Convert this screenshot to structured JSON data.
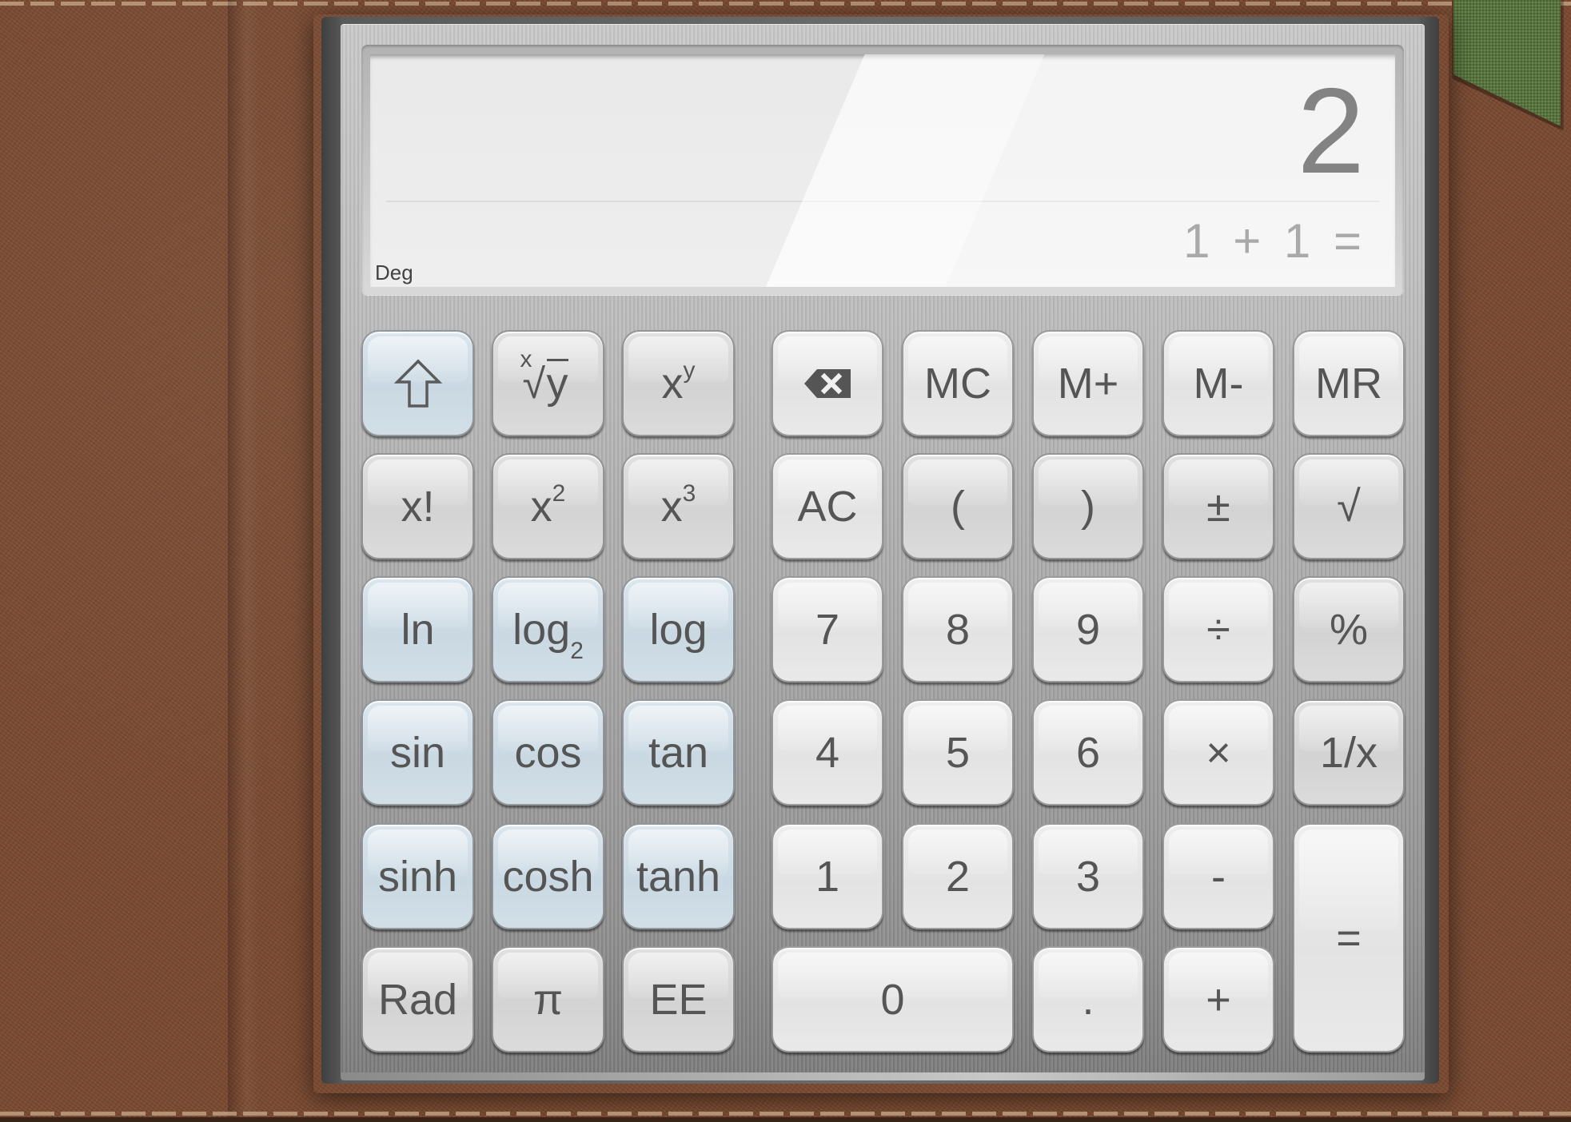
{
  "display": {
    "result": "2",
    "expression": "1 + 1 =",
    "angle_mode": "Deg"
  },
  "settings": {
    "icon": "gear-icon"
  },
  "keys": {
    "shift": {
      "icon": "shift-arrow-icon"
    },
    "root_xy": {
      "label": "ʸ",
      "root": "√",
      "index": "x",
      "radicand": "y"
    },
    "x_pow_y": {
      "base": "x",
      "exp": "y"
    },
    "backspace": {
      "icon": "backspace-icon"
    },
    "mc": "MC",
    "m_plus": "M+",
    "m_minus": "M-",
    "mr": "MR",
    "factorial": "x!",
    "x_squared": {
      "base": "x",
      "exp": "2"
    },
    "x_cubed": {
      "base": "x",
      "exp": "3"
    },
    "ac": "AC",
    "open_paren": "(",
    "close_paren": ")",
    "plus_minus": "±",
    "sqrt": "√",
    "ln": "ln",
    "log2": {
      "base": "log",
      "sub": "2"
    },
    "log": "log",
    "seven": "7",
    "eight": "8",
    "nine": "9",
    "divide": "÷",
    "percent": "%",
    "sin": "sin",
    "cos": "cos",
    "tan": "tan",
    "four": "4",
    "five": "5",
    "six": "6",
    "multiply": "×",
    "reciprocal": "1/x",
    "sinh": "sinh",
    "cosh": "cosh",
    "tanh": "tanh",
    "one": "1",
    "two": "2",
    "three": "3",
    "minus": "-",
    "equals": "=",
    "rad": "Rad",
    "pi": "π",
    "ee": "EE",
    "zero": "0",
    "decimal": ".",
    "plus": "+"
  },
  "colors": {
    "leather": "#7b4a31",
    "ribbon": "#56743a",
    "key_blue": "#cfdde6",
    "key_digit": "#e8e8e8",
    "key_func": "#d6d6d6",
    "text": "#555555"
  }
}
